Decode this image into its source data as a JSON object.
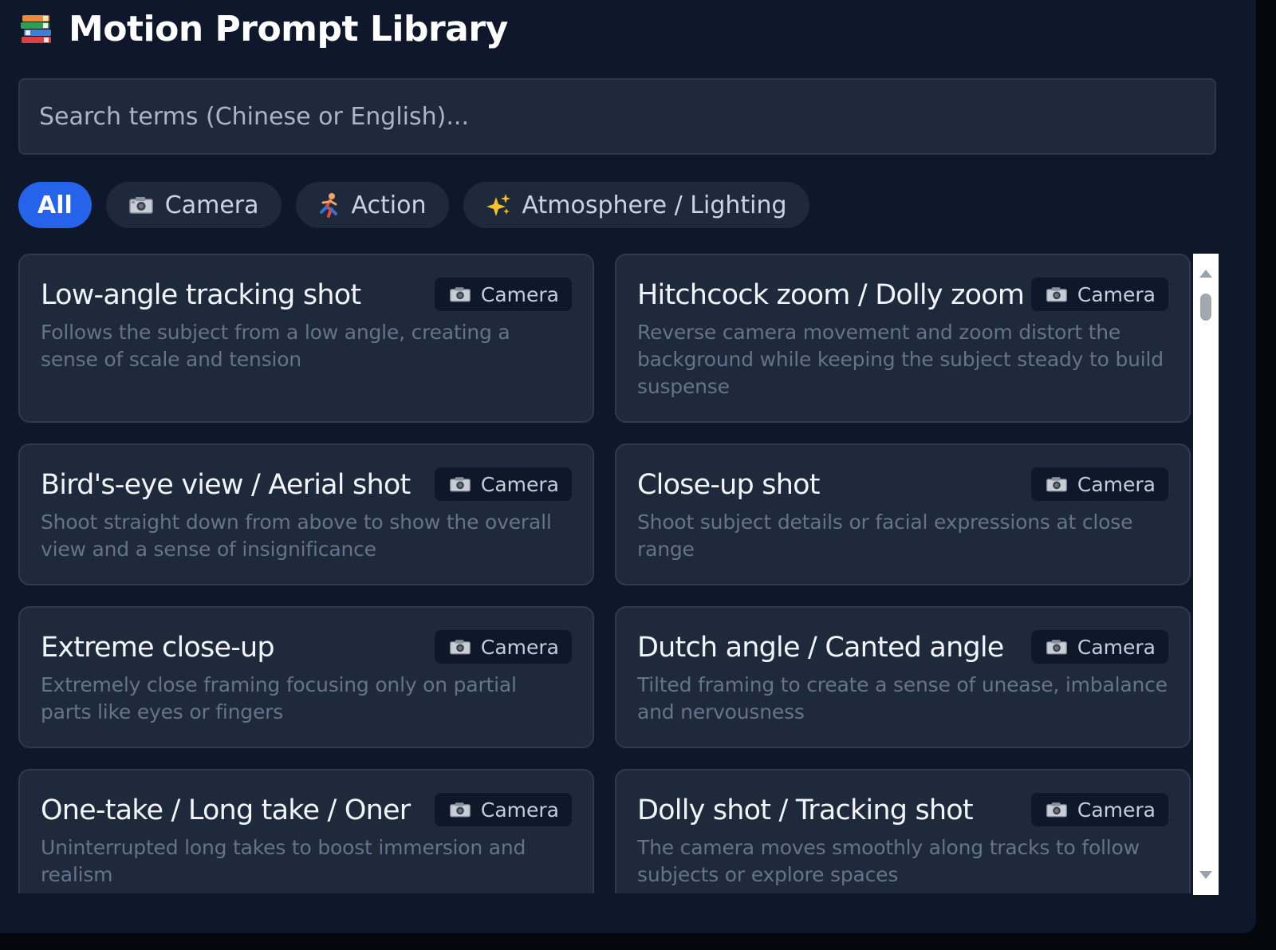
{
  "app": {
    "title": "Motion Prompt Library",
    "icon": "books-icon"
  },
  "search": {
    "placeholder": "Search terms (Chinese or English)...",
    "value": ""
  },
  "filters": [
    {
      "label": "All",
      "icon": "",
      "active": true
    },
    {
      "label": "Camera",
      "icon": "camera-icon",
      "active": false
    },
    {
      "label": "Action",
      "icon": "running-person-icon",
      "active": false
    },
    {
      "label": "Atmosphere / Lighting",
      "icon": "sparkles-icon",
      "active": false
    }
  ],
  "cards": [
    {
      "title": "Low-angle tracking shot",
      "category": "Camera",
      "description": "Follows the subject from a low angle, creating a sense of scale and tension"
    },
    {
      "title": "Hitchcock zoom / Dolly zoom",
      "category": "Camera",
      "description": "Reverse camera movement and zoom distort the background while keeping the subject steady to build suspense"
    },
    {
      "title": "Bird's-eye view / Aerial shot",
      "category": "Camera",
      "description": "Shoot straight down from above to show the overall view and a sense of insignificance"
    },
    {
      "title": "Close-up shot",
      "category": "Camera",
      "description": "Shoot subject details or facial expressions at close range"
    },
    {
      "title": "Extreme close-up",
      "category": "Camera",
      "description": "Extremely close framing focusing only on partial parts like eyes or fingers"
    },
    {
      "title": "Dutch angle / Canted angle",
      "category": "Camera",
      "description": "Tilted framing to create a sense of unease, imbalance and nervousness"
    },
    {
      "title": "One-take / Long take / Oner",
      "category": "Camera",
      "description": "Uninterrupted long takes to boost immersion and realism"
    },
    {
      "title": "Dolly shot / Tracking shot",
      "category": "Camera",
      "description": "The camera moves smoothly along tracks to follow subjects or explore spaces"
    }
  ],
  "colors": {
    "accent": "#2563eb",
    "panel": "#0f172a",
    "card": "#1e293b"
  }
}
